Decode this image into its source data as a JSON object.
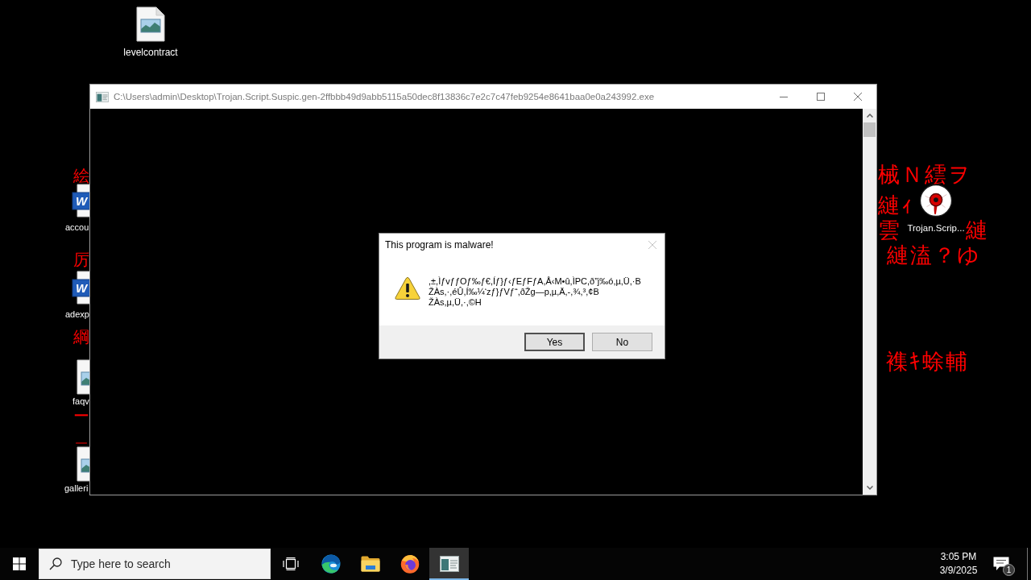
{
  "desktop": {
    "icons": [
      {
        "label": "levelcontract",
        "kind": "image"
      },
      {
        "label": "accou",
        "kind": "word",
        "badge": "W"
      },
      {
        "label": "adexp",
        "kind": "word",
        "badge": "W"
      },
      {
        "label": "faqv",
        "kind": "image"
      },
      {
        "label": "galleri",
        "kind": "image"
      },
      {
        "label": "Trojan.Scrip...",
        "kind": "malware"
      }
    ],
    "wallpaper_text": {
      "left": [
        "絵",
        "厉",
        "綱",
        "ー",
        "＿"
      ],
      "right": [
        "械Ｎ繧ヲ",
        "縺ｨ",
        "雲",
        "縺",
        "縺溘？ゆ",
        "襍ｷ蜍輔"
      ]
    }
  },
  "window": {
    "title": "C:\\Users\\admin\\Desktop\\Trojan.Script.Suspic.gen-2ffbbb49d9abb5115a50dec8f13836c7e2c7c47feb9254e8641baa0e0a243992.exe",
    "active": false
  },
  "dialog": {
    "title": "This program is malware!",
    "close_disabled": true,
    "message": ",±,ÌƒvƒƒOƒ‰ƒ€,Íƒ}ƒ‹ƒEƒFƒA,Å‹M•û,ÌPC,ð”j‰ó,µ,Ü,·B\nŽÀs,·,éÛ,Í‰¼‘zƒ}ƒVƒ“,ðŽg—p,µ,Ä,-,¾,³,¢B\nŽÀs,µ,Ü,·,©H",
    "buttons": [
      {
        "label": "Yes",
        "focused": true
      },
      {
        "label": "No",
        "focused": false
      }
    ]
  },
  "taskbar": {
    "search": {
      "placeholder": "Type here to search"
    },
    "apps": [
      {
        "kind": "task-view",
        "active": false
      },
      {
        "kind": "edge",
        "active": false
      },
      {
        "kind": "folder",
        "active": false
      },
      {
        "kind": "firefox",
        "active": false
      },
      {
        "kind": "console",
        "active": true
      }
    ],
    "clock": {
      "time": "3:05 PM",
      "date": "3/9/2025"
    },
    "notification_count": "1"
  }
}
